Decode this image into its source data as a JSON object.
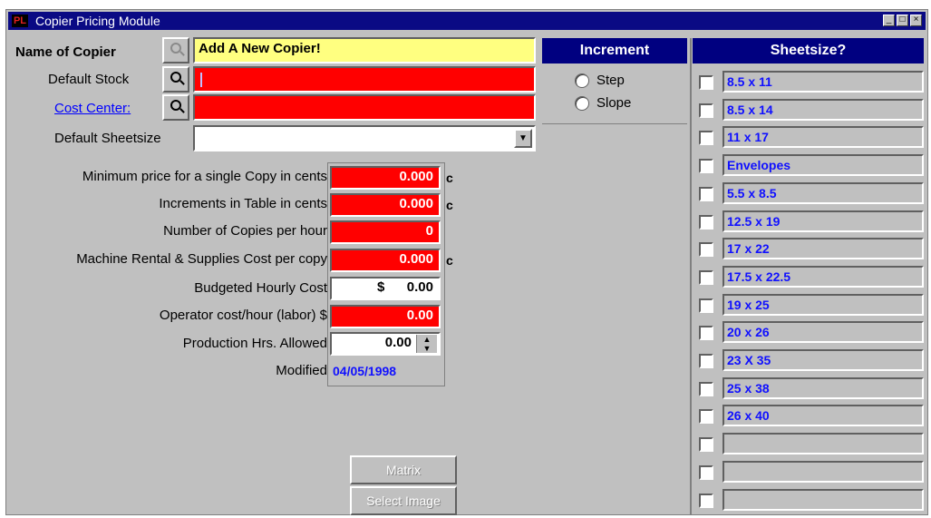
{
  "window": {
    "title": "Copier Pricing Module",
    "app_icon_text": "PL"
  },
  "form": {
    "name_label": "Name of Copier",
    "name_value": "Add A New Copier!",
    "stock_label": "Default Stock",
    "cost_center_label": "Cost Center:",
    "sheetsize_label": "Default Sheetsize",
    "rows": [
      {
        "label": "Minimum price for a single Copy in cents",
        "value": "0.000",
        "unit": "c"
      },
      {
        "label": "Increments in Table in cents",
        "value": "0.000",
        "unit": "c"
      },
      {
        "label": "Number of Copies per hour",
        "value": "0",
        "unit": ""
      },
      {
        "label": "Machine Rental & Supplies Cost per copy",
        "value": "0.000",
        "unit": "c"
      },
      {
        "label": "Budgeted Hourly Cost",
        "currency": "$",
        "value": "0.00"
      },
      {
        "label": "Operator cost/hour (labor) $",
        "value": "0.00"
      },
      {
        "label": "Production Hrs. Allowed",
        "value": "0.00"
      },
      {
        "label": "Modified",
        "value": "04/05/1998"
      }
    ]
  },
  "increment": {
    "header": "Increment",
    "options": [
      "Step",
      "Slope"
    ]
  },
  "sheetsize": {
    "header": "Sheetsize?",
    "items": [
      "8.5 x 11",
      "8.5 x 14",
      "11 x 17",
      "Envelopes",
      "5.5 x 8.5",
      "12.5 x 19",
      "17 x 22",
      "17.5 x 22.5",
      "19 x 25",
      "20 x 26",
      "23 X 35",
      "25 x 38",
      "26 x 40",
      "",
      "",
      ""
    ]
  },
  "buttons": {
    "matrix": "Matrix",
    "select_image": "Select Image"
  },
  "colors": {
    "title_bar": "#0a0a84",
    "header": "#000080",
    "required_field": "#ff0000",
    "name_field": "#ffff80",
    "sheetsize_text": "#1010ff"
  }
}
